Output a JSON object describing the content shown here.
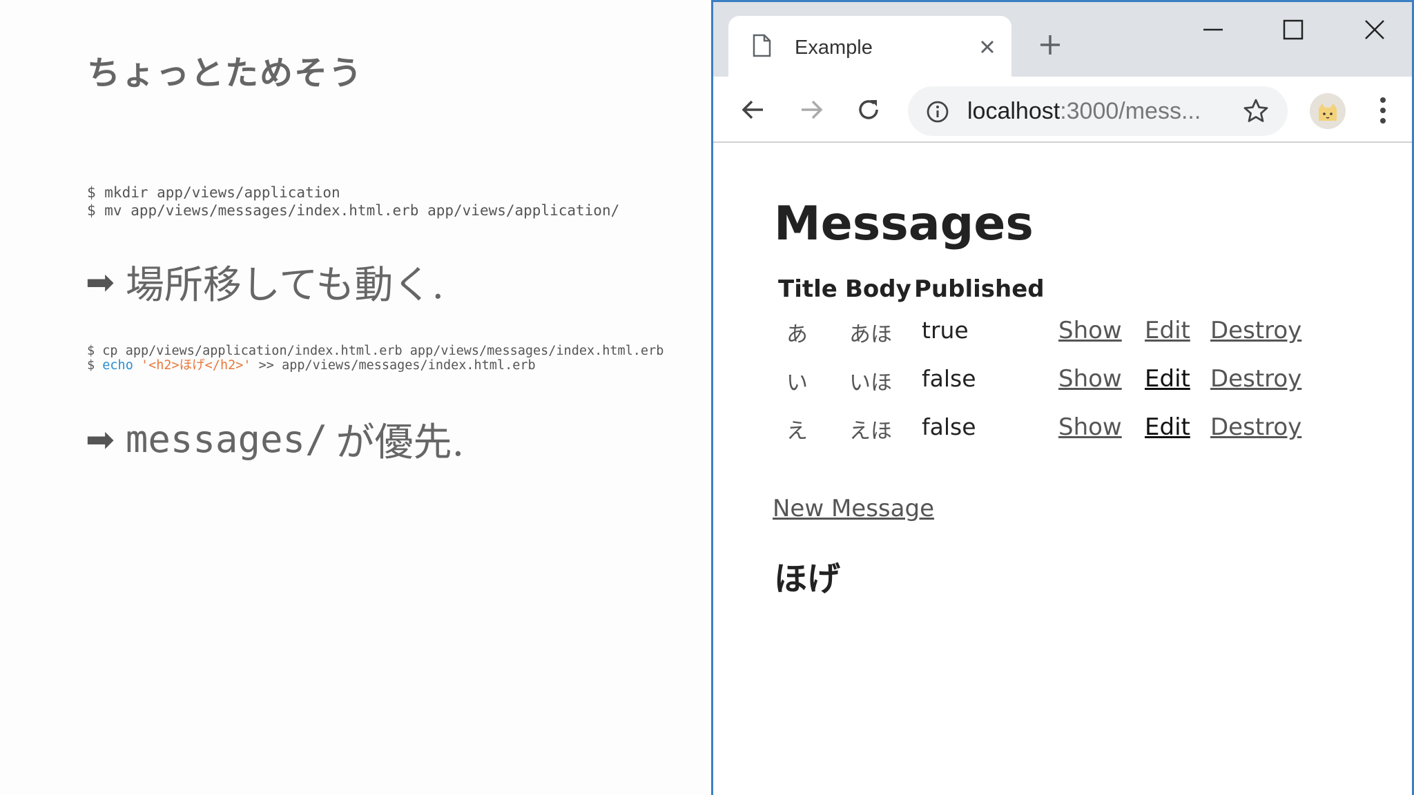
{
  "slide": {
    "title": "ちょっとためそう",
    "code1": {
      "line1": "$ mkdir app/views/application",
      "line2": "$ mv app/views/messages/index.html.erb app/views/application/"
    },
    "bullet1": {
      "arrow": "➡",
      "text": "場所移しても動く."
    },
    "code2": {
      "line1": "$ cp app/views/application/index.html.erb app/views/messages/index.html.erb",
      "line2_prompt": "$ ",
      "line2_cmd": "echo",
      "line2_str": "'<h2>ほげ</h2>'",
      "line2_rest": " >> app/views/messages/index.html.erb"
    },
    "bullet2": {
      "arrow": "➡",
      "mono": "messages/",
      "text": "が優先."
    },
    "colors": {
      "code_command": "#2a8fd2",
      "code_string": "#e8783c"
    }
  },
  "browser": {
    "tab": {
      "title": "Example",
      "icon": "page-icon"
    },
    "address": {
      "host": "localhost",
      "rest": ":3000/mess..."
    },
    "page": {
      "heading": "Messages",
      "table": {
        "headers": [
          "Title",
          "Body",
          "Published"
        ],
        "rows": [
          {
            "title": "あ",
            "body": "あほ",
            "published": "true",
            "show": "Show",
            "edit": "Edit",
            "destroy": "Destroy"
          },
          {
            "title": "い",
            "body": "いほ",
            "published": "false",
            "show": "Show",
            "edit": "Edit",
            "destroy": "Destroy"
          },
          {
            "title": "え",
            "body": "えほ",
            "published": "false",
            "show": "Show",
            "edit": "Edit",
            "destroy": "Destroy"
          }
        ]
      },
      "new_link": "New Message",
      "subheading": "ほげ"
    }
  }
}
